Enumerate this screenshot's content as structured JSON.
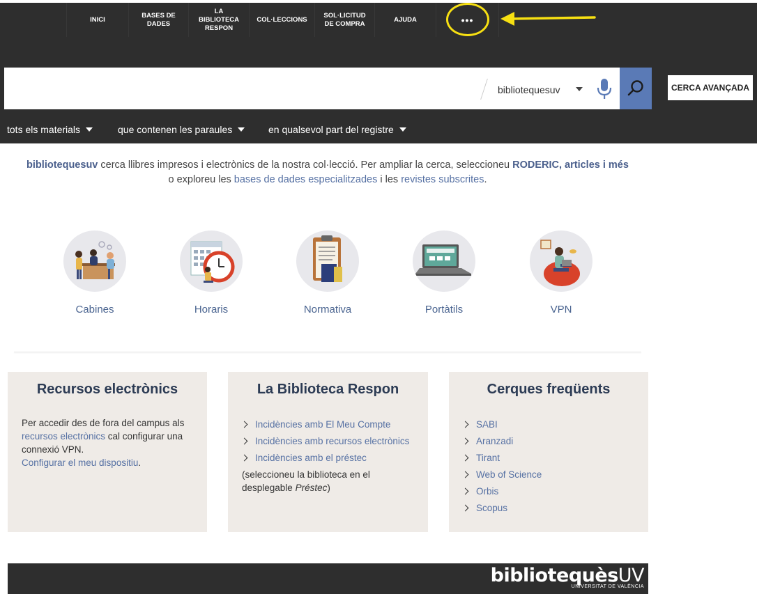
{
  "nav": {
    "items": [
      {
        "label": "INICI"
      },
      {
        "label": "BASES DE\nDADES"
      },
      {
        "label": "LA\nBIBLIOTECA\nRESPON"
      },
      {
        "label": "COL·LECCIONS"
      },
      {
        "label": "SOL·LICITUD\nDE COMPRA"
      },
      {
        "label": "AJUDA"
      }
    ],
    "more_label": "•••"
  },
  "search": {
    "query_value": "",
    "scope": "bibliotequesuv",
    "advanced_label": "CERCA AVANÇADA",
    "filters": [
      {
        "label": "tots els materials"
      },
      {
        "label": "que contenen les paraules"
      },
      {
        "label": "en qualsevol part del registre"
      }
    ]
  },
  "intro": {
    "brand": "bibliotequesuv",
    "text1": " cerca llibres impresos i electrònics de la nostra col·lecció. Per ampliar la cerca, seleccioneu ",
    "roderic": "RODERIC, articles i més",
    "text2": "o exploreu les ",
    "bases_link": "bases de dades especialitzades",
    "text3": " i les ",
    "revistes_link": "revistes subscrites",
    "text4": "."
  },
  "quick_links": [
    {
      "label": "Cabines",
      "icon": "booth-people-icon"
    },
    {
      "label": "Horaris",
      "icon": "calendar-clock-icon"
    },
    {
      "label": "Normativa",
      "icon": "clipboard-rules-icon"
    },
    {
      "label": "Portàtils",
      "icon": "laptop-icon"
    },
    {
      "label": "VPN",
      "icon": "person-laptop-icon"
    }
  ],
  "cards": {
    "recursos": {
      "title": "Recursos electrònics",
      "text1": "Per accedir des de fora del campus als ",
      "link1": "recursos electrònics",
      "text2": " cal configurar una connexió VPN.",
      "link2": "Configurar el meu dispositiu",
      "text3": "."
    },
    "respon": {
      "title": "La Biblioteca Respon",
      "items": [
        {
          "label": "Incidències amb El Meu Compte"
        },
        {
          "label": "Incidències amb recursos electrònics"
        },
        {
          "label": "Incidències amb el préstec"
        }
      ],
      "note1": "(seleccioneu la biblioteca en el desplegable ",
      "note_em": "Préstec",
      "note2": ")"
    },
    "cerques": {
      "title": "Cerques freqüents",
      "items": [
        {
          "label": "SABI"
        },
        {
          "label": "Aranzadi"
        },
        {
          "label": "Tirant"
        },
        {
          "label": "Web of Science"
        },
        {
          "label": "Orbis"
        },
        {
          "label": "Scopus"
        }
      ]
    }
  },
  "footer": {
    "logo_main": "bibliotequès",
    "logo_uv": "UV",
    "logo_sub": "UNIVERSITAT DE VALÈNCIA"
  },
  "colors": {
    "nav_bg": "#2e2e2e",
    "accent_blue": "#5a7ab6",
    "link_blue": "#5570a3",
    "card_bg": "#efebe7",
    "highlight_yellow": "#f7e012"
  }
}
